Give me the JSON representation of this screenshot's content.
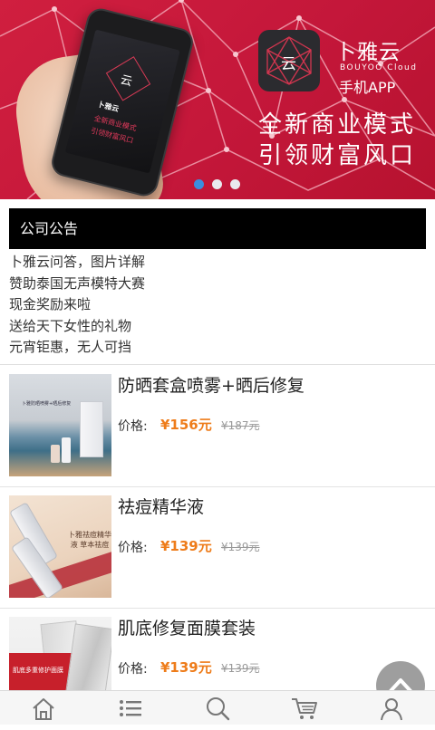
{
  "banner": {
    "brand_name": "卜雅云",
    "brand_en": "BOUYOO Cloud",
    "brand_app": "手机APP",
    "icon_char": "云",
    "slogan_line1": "全新商业模式",
    "slogan_line2": "引领财富风口",
    "phone_screen": {
      "logo_char": "云",
      "line1": "卜雅云",
      "line2": "全新商业模式",
      "line3": "引领财富风口"
    },
    "active_dot": 0,
    "dot_count": 3,
    "colors": {
      "background": "#c81c3b",
      "active_dot": "#3a8ee0",
      "inactive_dot": "#e9e9ee"
    }
  },
  "notice": {
    "title": "公司公告",
    "items": [
      "卜雅云问答，图片详解",
      "赞助泰国无声模特大赛",
      "现金奖励来啦",
      "送给天下女性的礼物",
      "元宵钜惠，无人可挡"
    ]
  },
  "products": [
    {
      "title": "防晒套盒喷雾+晒后修复",
      "price_label": "价格:",
      "price": "¥156元",
      "old_price": "¥187元",
      "thumb_text": "卜雅防晒喷雾+晒后修复"
    },
    {
      "title": "祛痘精华液",
      "price_label": "价格:",
      "price": "¥139元",
      "old_price": "¥139元",
      "thumb_text": "卜雅祛痘精华液 草本祛痘"
    },
    {
      "title": "肌底修复面膜套装",
      "price_label": "价格:",
      "price": "¥139元",
      "old_price": "¥139元",
      "thumb_text": "肌底多重修护面膜"
    }
  ],
  "price_color": "#ee7c1a",
  "bottom_nav": {
    "items": [
      {
        "icon": "home-icon"
      },
      {
        "icon": "list-icon"
      },
      {
        "icon": "search-icon"
      },
      {
        "icon": "cart-icon"
      },
      {
        "icon": "user-icon"
      }
    ]
  },
  "scroll_top_icon": "chevron-up-icon"
}
